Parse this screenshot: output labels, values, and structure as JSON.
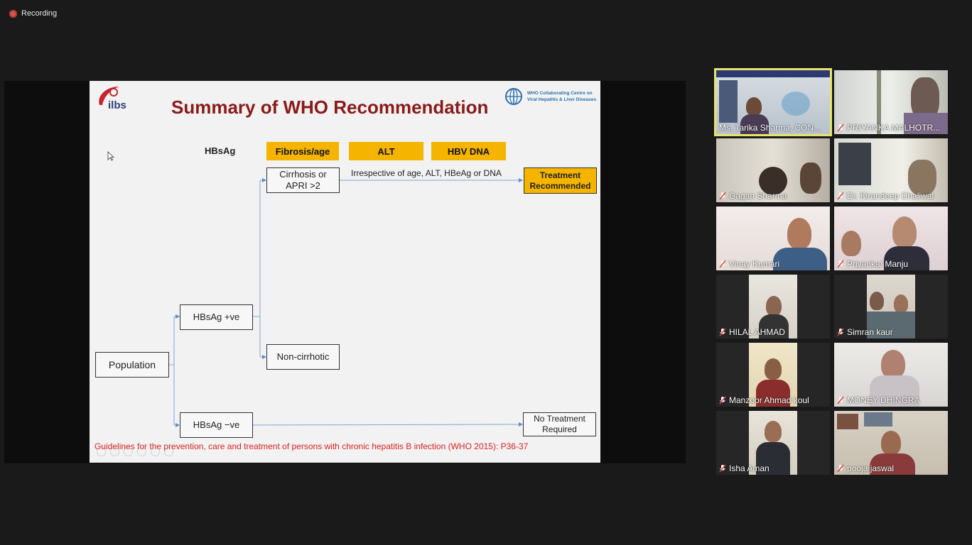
{
  "recording": {
    "label": "Recording"
  },
  "slide": {
    "logo_text": "ilbs",
    "who_text": [
      "WHO Collaborating Centre on",
      "Viral Hepatitis & Liver Diseases"
    ],
    "title": "Summary of WHO Recommendation",
    "headers": {
      "hbsag": "HBsAg",
      "fibrosis": "Fibrosis/age",
      "alt": "ALT",
      "dna": "HBV DNA"
    },
    "boxes": {
      "cirrhosis": "Cirrhosis or\nAPRI >2",
      "treatment": "Treatment\nRecommended",
      "hbsag_pos": "HBsAg +ve",
      "population": "Population",
      "non_cirrhotic": "Non-cirrhotic",
      "hbsag_neg": "HBsAg −ve",
      "no_treatment": "No Treatment\nRequired"
    },
    "irrespective": "Irrespective of age, ALT, HBeAg or DNA",
    "citation": "Guidelines for the prevention, care and treatment of persons with chronic hepatitis B infection (WHO 2015): P36-37"
  },
  "participants": [
    {
      "name": "Ms. Tarika Sharma, CON...",
      "muted": false,
      "active": true
    },
    {
      "name": "PRIYANKA MALHOTR...",
      "muted": true
    },
    {
      "name": "Gagan Sharma",
      "muted": true
    },
    {
      "name": "Dr. Kirandeep Dhaliwal",
      "muted": true
    },
    {
      "name": "Vinay Kumari",
      "muted": true
    },
    {
      "name": "Priyanka/ Manju",
      "muted": true
    },
    {
      "name": "HILAL AHMAD",
      "muted": true
    },
    {
      "name": "Simran kaur",
      "muted": true
    },
    {
      "name": "Manzoor Ahmad koul",
      "muted": true
    },
    {
      "name": "MONEY DHINGRA",
      "muted": true
    },
    {
      "name": "Isha  Aman",
      "muted": true
    },
    {
      "name": "pooja jaswal",
      "muted": true
    }
  ],
  "colors": {
    "title": "#8b1a1a",
    "header_box": "#f4b400",
    "active_speaker": "#e8e46a",
    "muted": "#e0453f"
  }
}
